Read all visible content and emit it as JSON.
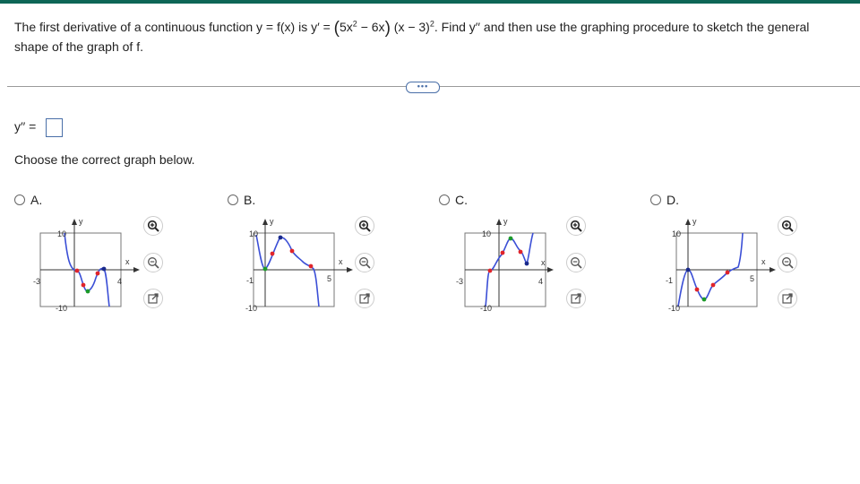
{
  "question": {
    "p1": "The first derivative of a continuous function y = f(x) is y′ = ",
    "lp": "(",
    "f1a": "5x",
    "f1b": "2",
    "f1c": " − 6x",
    "rp": ")",
    "f2a": " (x − 3)",
    "f2b": "2",
    "p2": ". Find y′′ and then use the graphing procedure to sketch the general shape of the graph of f."
  },
  "more_button": "•••",
  "answer": {
    "label": "y′′ =",
    "value": ""
  },
  "choose_text": "Choose the correct graph below.",
  "options": [
    {
      "label": "A.",
      "graph": {
        "x_min_label": "-3",
        "x_max_label": "4",
        "y_top_label": "10",
        "y_bot_label": "-10",
        "x_axis": "x",
        "y_axis": "y"
      }
    },
    {
      "label": "B.",
      "graph": {
        "x_min_label": "-1",
        "x_max_label": "5",
        "y_top_label": "10",
        "y_bot_label": "-10",
        "x_axis": "x",
        "y_axis": "y"
      }
    },
    {
      "label": "C.",
      "graph": {
        "x_min_label": "-3",
        "x_max_label": "4",
        "y_top_label": "10",
        "y_bot_label": "-10",
        "x_axis": "x",
        "y_axis": "y"
      }
    },
    {
      "label": "D.",
      "graph": {
        "x_min_label": "-1",
        "x_max_label": "5",
        "y_top_label": "10",
        "y_bot_label": "-10",
        "x_axis": "x",
        "y_axis": "y"
      }
    }
  ],
  "icons": {
    "zoom_in": "zoom-in-icon",
    "zoom_out": "zoom-out-icon",
    "popout": "popout-icon"
  },
  "colors": {
    "topbar": "#0e6656",
    "curve": "#3b4fd6",
    "max_point": "#1a2a8c",
    "min_point": "#1c9a2a",
    "inflection": "#e0242a",
    "link": "#4a6fa8"
  }
}
